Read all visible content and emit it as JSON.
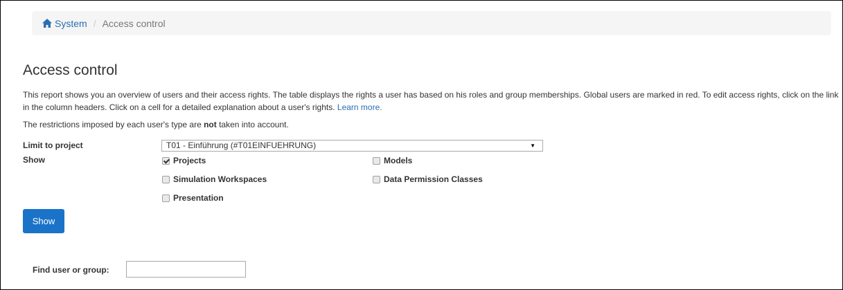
{
  "breadcrumb": {
    "home_label": "System",
    "current_label": "Access control",
    "separator": "/"
  },
  "page": {
    "title": "Access control",
    "intro_text": "This report shows you an overview of users and their access rights. The table displays the rights a user has based on his roles and group memberships. Global users are marked in red. To edit access rights, click on the link in the column headers. Click on a cell for a detailed explanation about a user's rights. ",
    "learn_more": "Learn more.",
    "restriction_prefix": "The restrictions imposed by each user's type are ",
    "restriction_bold": "not",
    "restriction_suffix": " taken into account."
  },
  "filters": {
    "limit_label": "Limit to project",
    "limit_value": "T01 - Einführung (#T01EINFUEHRUNG)",
    "show_label": "Show",
    "options": {
      "projects": {
        "label": "Projects",
        "checked": true
      },
      "models": {
        "label": "Models",
        "checked": false
      },
      "simulation": {
        "label": "Simulation Workspaces",
        "checked": false
      },
      "data_permission": {
        "label": "Data Permission Classes",
        "checked": false
      },
      "presentation": {
        "label": "Presentation",
        "checked": false
      }
    }
  },
  "actions": {
    "show_button": "Show"
  },
  "search": {
    "label": "Find user or group:",
    "value": ""
  },
  "colors": {
    "link": "#2a6fb3",
    "primary_button": "#1a73c9",
    "breadcrumb_bg": "#f5f5f5"
  },
  "icons": {
    "home": "home-icon",
    "select_arrow": "chevron-down-icon"
  }
}
